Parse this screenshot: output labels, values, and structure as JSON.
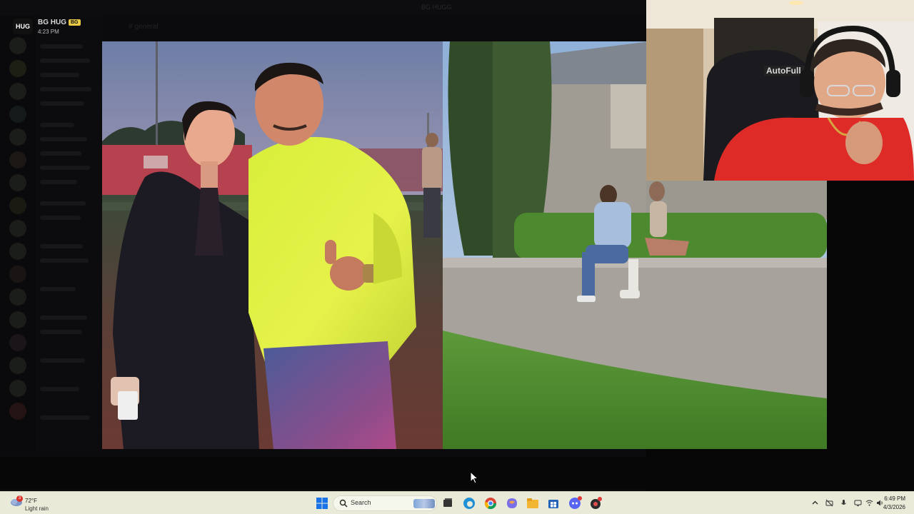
{
  "window": {
    "title": "BG HUGG"
  },
  "background_app": {
    "header_label": "# general"
  },
  "overlay": {
    "logo_text": "HUG",
    "name": "BG HUG",
    "badge": "BG",
    "time": "4:23 PM"
  },
  "scene": {
    "left_photo": "photo",
    "right_photo": "render",
    "jersey_text": "AutoFull"
  },
  "taskbar": {
    "weather": {
      "temp": "72°F",
      "desc": "Light rain",
      "alert_count": "3"
    },
    "search_label": "Search",
    "apps": [
      {
        "name": "start-icon"
      },
      {
        "name": "task-view-icon"
      },
      {
        "name": "edge-icon"
      },
      {
        "name": "chrome-icon"
      },
      {
        "name": "copilot-icon"
      },
      {
        "name": "file-explorer-icon"
      },
      {
        "name": "store-icon"
      },
      {
        "name": "discord-icon"
      },
      {
        "name": "app-icon"
      }
    ],
    "clock": {
      "time": "6:49 PM",
      "date": "4/3/2026"
    }
  }
}
